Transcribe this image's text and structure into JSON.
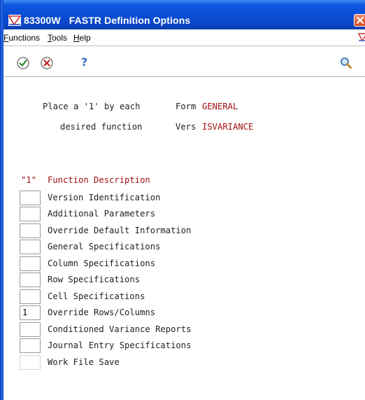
{
  "window": {
    "program": "83300W",
    "title": "FASTR Definition Options"
  },
  "menu": {
    "functions": "Functions",
    "tools": "Tools",
    "help": "Help"
  },
  "toolbar": {
    "ok_icon": "check-circle-icon",
    "cancel_icon": "x-circle-icon",
    "help_label": "?",
    "search_icon": "magnifier-icon"
  },
  "form": {
    "instruction_line1": "Place a '1' by each",
    "instruction_line2": "desired function",
    "form_label": "Form",
    "form_value": "GENERAL",
    "vers_label": "Vers",
    "vers_value": "ISVARIANCE"
  },
  "list": {
    "header_col1": "\"1\"",
    "header_col2": "Function Description",
    "rows": [
      {
        "value": "",
        "label": "Version Identification"
      },
      {
        "value": "",
        "label": "Additional Parameters"
      },
      {
        "value": "",
        "label": "Override Default Information"
      },
      {
        "value": "",
        "label": "General Specifications"
      },
      {
        "value": "",
        "label": "Column Specifications"
      },
      {
        "value": "",
        "label": "Row Specifications"
      },
      {
        "value": "",
        "label": "Cell Specifications"
      },
      {
        "value": "1",
        "label": "Override Rows/Columns"
      },
      {
        "value": "",
        "label": "Conditioned Variance Reports"
      },
      {
        "value": "",
        "label": "Journal Entry Specifications"
      },
      {
        "value": "",
        "label": "Work File Save"
      }
    ]
  },
  "colors": {
    "title_blue": "#0a4ed6",
    "value_red": "#a01010",
    "close_red": "#d8451f"
  }
}
